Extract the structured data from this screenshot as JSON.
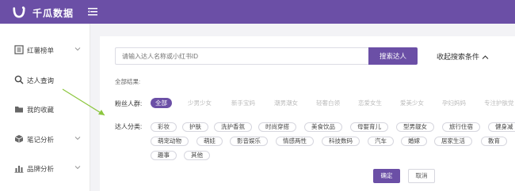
{
  "app": {
    "brand": "千瓜数据"
  },
  "colors": {
    "topbar": "#6b4fa6",
    "accent": "#6b4fa6",
    "arrow": "#8cc63e"
  },
  "sidebar": {
    "items": [
      {
        "label": "红薯榜单",
        "icon": "list-icon"
      },
      {
        "label": "达人查询",
        "icon": "search-icon"
      },
      {
        "label": "我的收藏",
        "icon": "folder-icon"
      },
      {
        "label": "笔记分析",
        "icon": "cube-icon"
      },
      {
        "label": "品牌分析",
        "icon": "bar-chart-icon"
      }
    ]
  },
  "search": {
    "placeholder": "请输入达人名称或小红书ID",
    "button": "搜索达人",
    "collapse": "收起搜索条件"
  },
  "all_results": "全部结果:",
  "fans": {
    "label": "粉丝人群:",
    "options": [
      "全部",
      "少男少女",
      "新手宝妈",
      "潮男潮女",
      "轻奢白领",
      "恋爱女生",
      "爱美少女",
      "孕妇妈妈",
      "专注护肤党"
    ],
    "selected": "全部"
  },
  "category": {
    "label": "达人分类:",
    "row1": [
      "彩妆",
      "护肤",
      "洗护香氛",
      "时尚穿搭",
      "美食饮品",
      "母婴育儿",
      "型男靓女",
      "旅行住宿",
      "健身减"
    ],
    "row2": [
      "萌宠动物",
      "萌娃",
      "影音娱乐",
      "情感两性",
      "科技数码",
      "汽车",
      "婚嫁",
      "居家生活",
      "教育"
    ],
    "row3": [
      "趣事",
      "其他"
    ]
  },
  "actions": {
    "ok": "确定",
    "cancel": "取消"
  }
}
